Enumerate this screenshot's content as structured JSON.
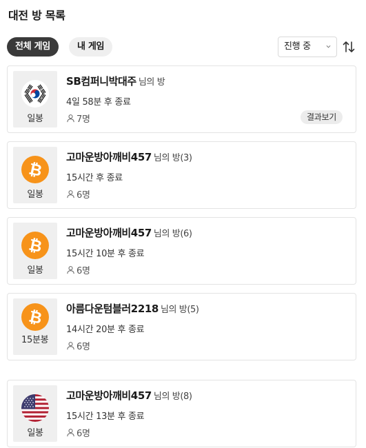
{
  "header": {
    "title": "대전 방 목록"
  },
  "filters": {
    "all_games": "전체 게임",
    "my_games": "내 게임",
    "status_select": "진행 중"
  },
  "icons": {
    "select_chevron": "chevron-down-icon",
    "sort": "sort-arrows-icon",
    "players": "person-icon",
    "bitcoin": "bitcoin-icon",
    "korea_flag": "korea-flag-icon",
    "us_flag": "us-flag-icon"
  },
  "colors": {
    "bitcoin": "#F7931A",
    "active_chip": "#3A3A3A"
  },
  "rooms": [
    {
      "icon": "korea-flag-icon",
      "type": "일봉",
      "name": "SB컴퍼니박대주",
      "suffix": "님의 방",
      "time": "4일 58분 후 종료",
      "players": "7명",
      "action": "결과보기"
    },
    {
      "icon": "bitcoin-icon",
      "type": "일봉",
      "name": "고마운방아깨비457",
      "suffix": "님의 방(3)",
      "time": "15시간 후 종료",
      "players": "6명"
    },
    {
      "icon": "bitcoin-icon",
      "type": "일봉",
      "name": "고마운방아깨비457",
      "suffix": "님의 방(6)",
      "time": "15시간 10분 후 종료",
      "players": "6명"
    },
    {
      "icon": "bitcoin-icon",
      "type": "15분봉",
      "name": "아름다운텀블러2218",
      "suffix": "님의 방(5)",
      "time": "14시간 20분 후 종료",
      "players": "6명"
    },
    {
      "icon": "us-flag-icon",
      "type": "일봉",
      "name": "고마운방아깨비457",
      "suffix": "님의 방(8)",
      "time": "15시간 13분 후 종료",
      "players": "6명"
    }
  ]
}
